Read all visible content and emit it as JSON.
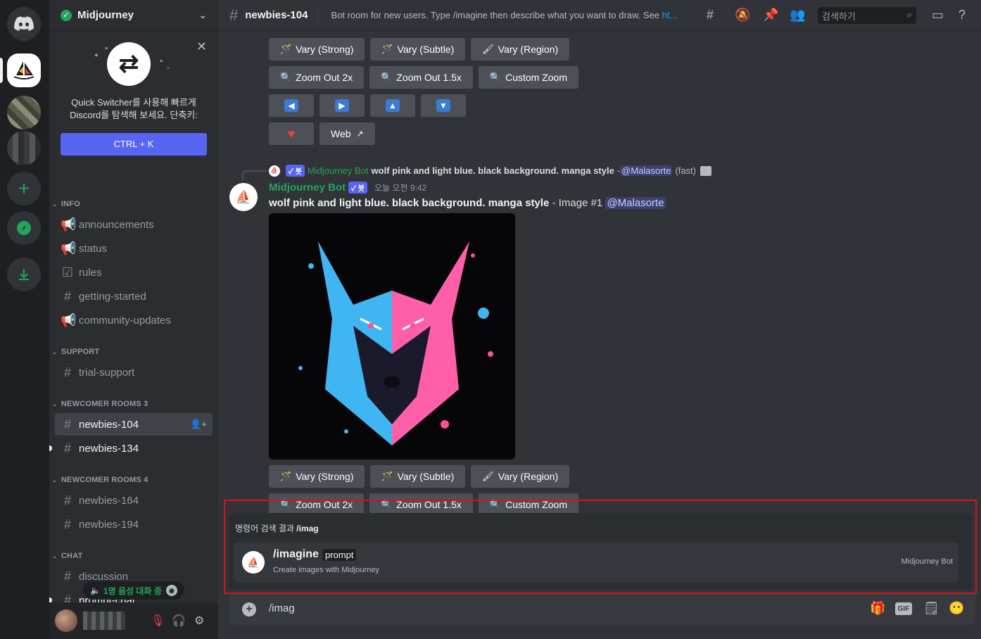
{
  "server": {
    "name": "Midjourney",
    "quick_switcher": {
      "text_line1": "Quick Switcher를 사용해 빠르게",
      "text_line2": "Discord를 탐색해 보세요. 단축키:",
      "shortcut": "CTRL + K"
    }
  },
  "sidebar": {
    "categories": [
      {
        "name": "INFO"
      },
      {
        "name": "SUPPORT"
      },
      {
        "name": "NEWCOMER ROOMS 3"
      },
      {
        "name": "NEWCOMER ROOMS 4"
      },
      {
        "name": "CHAT"
      }
    ],
    "channels": [
      {
        "name": "announcements",
        "icon": "megaphone-icon"
      },
      {
        "name": "status",
        "icon": "megaphone-icon"
      },
      {
        "name": "rules",
        "icon": "checkbox-icon"
      },
      {
        "name": "getting-started",
        "icon": "hash-icon"
      },
      {
        "name": "community-updates",
        "icon": "megaphone-icon"
      },
      {
        "name": "trial-support",
        "icon": "hash-icon"
      },
      {
        "name": "newbies-104",
        "icon": "threads-icon",
        "active": true
      },
      {
        "name": "newbies-134",
        "icon": "threads-icon",
        "unread": true
      },
      {
        "name": "newbies-164",
        "icon": "threads-icon"
      },
      {
        "name": "newbies-194",
        "icon": "threads-icon"
      },
      {
        "name": "discussion",
        "icon": "hash-icon"
      },
      {
        "name": "prompt-chat",
        "icon": "hash-icon"
      }
    ],
    "voice_status": "1명 음성 대화 중"
  },
  "channel": {
    "name": "newbies-104",
    "topic_prefix": "Bot room for new users. Type /imagine then describe what you want to draw. See ",
    "topic_link": "ht...",
    "search_placeholder": "검색하기"
  },
  "buttons": {
    "vary_strong": "Vary (Strong)",
    "vary_subtle": "Vary (Subtle)",
    "vary_region": "Vary (Region)",
    "zoom_out_2x": "Zoom Out 2x",
    "zoom_out_1_5x": "Zoom Out 1.5x",
    "custom_zoom": "Custom Zoom",
    "web": "Web"
  },
  "message": {
    "reply_bot": "Midjourney Bot",
    "reply_prompt": "wolf pink and light blue. black background. manga style",
    "reply_mention": "@Malasorte",
    "reply_suffix": "(fast)",
    "author": "Midjourney Bot",
    "bot_tag": "✓ 봇",
    "timestamp": "오늘 오전 9:42",
    "prompt": "wolf pink and light blue. black background. manga style",
    "image_label": " - Image #1 ",
    "mention": "@Malasorte",
    "dash": " - "
  },
  "autocomplete": {
    "title_prefix": "명령어 검색 결과 ",
    "query": "/imag",
    "command": "/imagine",
    "param": "prompt",
    "description": "Create images with Midjourney",
    "source": "Midjourney Bot"
  },
  "input": {
    "value": "/imag"
  },
  "colors": {
    "blurple": "#5865f2",
    "green": "#23a55a",
    "highlight_box": "#d0161a",
    "wolf_pink": "#ff4f9a",
    "wolf_blue": "#3fb6f2"
  }
}
